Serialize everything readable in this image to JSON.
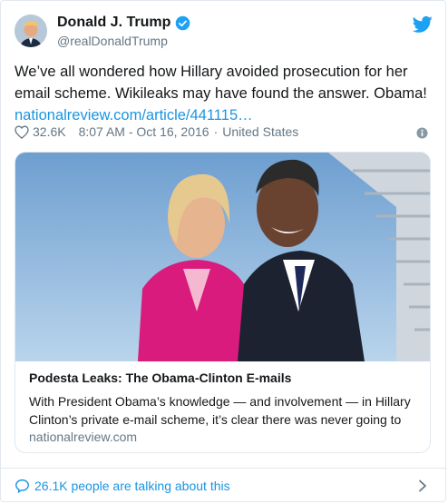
{
  "author": {
    "name": "Donald J. Trump",
    "handle": "@realDonaldTrump",
    "verified": true,
    "avatar_icon": "user-avatar"
  },
  "tweet": {
    "text_line1": "We’ve all wondered how Hillary avoided prosecution for her",
    "text_line2": "email scheme. Wikileaks may have found the answer. Obama!",
    "link_text": "nationalreview.com/article/441115…",
    "likes": "32.6K",
    "timestamp": "8:07 AM - Oct 16, 2016",
    "separator": "·",
    "location": "United States"
  },
  "link_card": {
    "title": "Podesta Leaks: The Obama-Clinton E-mails",
    "description": "With President Obama’s knowledge — and involvement — in Hillary Clinton’s private e-mail scheme, it’s clear there was never going to",
    "domain": "nationalreview.com"
  },
  "footer": {
    "talking_label": "26.1K people are talking about this"
  },
  "colors": {
    "link": "#1b95e0",
    "muted": "#657786",
    "text": "#14171a",
    "border": "#e1e8ed"
  }
}
